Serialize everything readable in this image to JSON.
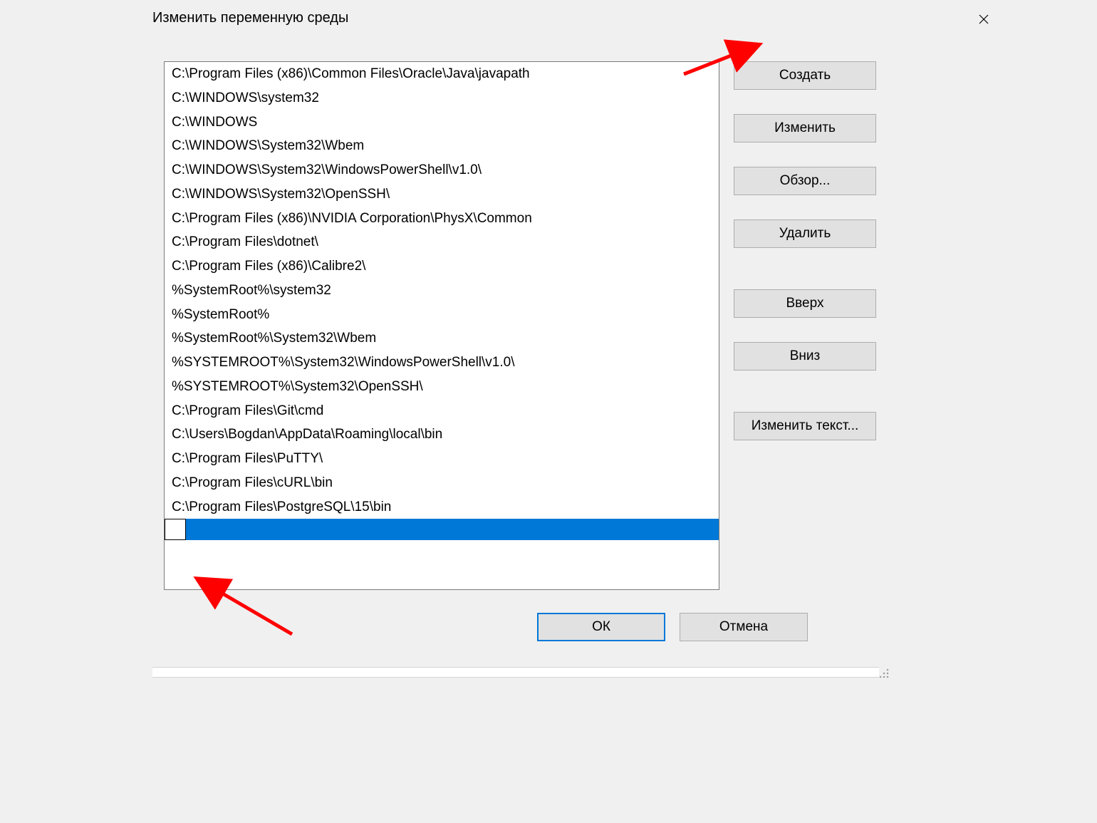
{
  "dialog": {
    "title": "Изменить переменную среды"
  },
  "paths": [
    "C:\\Program Files (x86)\\Common Files\\Oracle\\Java\\javapath",
    "C:\\WINDOWS\\system32",
    "C:\\WINDOWS",
    "C:\\WINDOWS\\System32\\Wbem",
    "C:\\WINDOWS\\System32\\WindowsPowerShell\\v1.0\\",
    "C:\\WINDOWS\\System32\\OpenSSH\\",
    "C:\\Program Files (x86)\\NVIDIA Corporation\\PhysX\\Common",
    "C:\\Program Files\\dotnet\\",
    "C:\\Program Files (x86)\\Calibre2\\",
    "%SystemRoot%\\system32",
    "%SystemRoot%",
    "%SystemRoot%\\System32\\Wbem",
    "%SYSTEMROOT%\\System32\\WindowsPowerShell\\v1.0\\",
    "%SYSTEMROOT%\\System32\\OpenSSH\\",
    "C:\\Program Files\\Git\\cmd",
    "C:\\Users\\Bogdan\\AppData\\Roaming\\local\\bin",
    "C:\\Program Files\\PuTTY\\",
    "C:\\Program Files\\cURL\\bin",
    "C:\\Program Files\\PostgreSQL\\15\\bin"
  ],
  "editing_value": "",
  "buttons": {
    "new": "Создать",
    "edit": "Изменить",
    "browse": "Обзор...",
    "delete": "Удалить",
    "up": "Вверх",
    "down": "Вниз",
    "edit_text": "Изменить текст..."
  },
  "footer": {
    "ok": "ОК",
    "cancel": "Отмена"
  }
}
